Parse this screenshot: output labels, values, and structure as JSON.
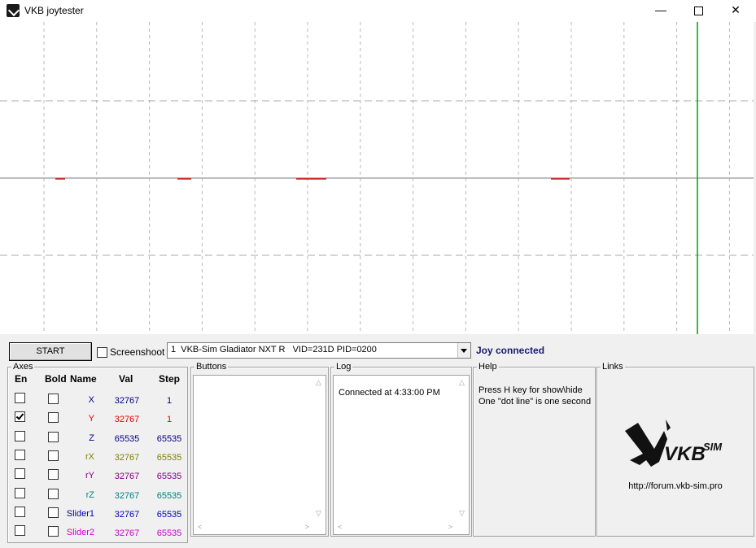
{
  "window": {
    "title": "VKB joytester"
  },
  "controls": {
    "start_label": "START",
    "screenshot_label": "Screenshoot",
    "screenshot_checked": false,
    "device": "1  VKB-Sim Gladiator NXT R   VID=231D PID=0200",
    "status": "Joy connected"
  },
  "axes": {
    "title": "Axes",
    "headers": {
      "en": "En",
      "bold": "Bold",
      "name": "Name",
      "val": "Val",
      "step": "Step"
    },
    "rows": [
      {
        "name": "X",
        "val": "32767",
        "step": "1",
        "color": "#000080",
        "en": false,
        "bold": false
      },
      {
        "name": "Y",
        "val": "32767",
        "step": "1",
        "color": "#e00000",
        "en": true,
        "bold": false
      },
      {
        "name": "Z",
        "val": "65535",
        "step": "65535",
        "color": "#000080",
        "en": false,
        "bold": false
      },
      {
        "name": "rX",
        "val": "32767",
        "step": "65535",
        "color": "#808000",
        "en": false,
        "bold": false
      },
      {
        "name": "rY",
        "val": "32767",
        "step": "65535",
        "color": "#800080",
        "en": false,
        "bold": false
      },
      {
        "name": "rZ",
        "val": "32767",
        "step": "65535",
        "color": "#008080",
        "en": false,
        "bold": false
      },
      {
        "name": "Slider1",
        "val": "32767",
        "step": "65535",
        "color": "#0000c0",
        "en": false,
        "bold": false
      },
      {
        "name": "Slider2",
        "val": "32767",
        "step": "65535",
        "color": "#d000d0",
        "en": false,
        "bold": false
      }
    ]
  },
  "buttons": {
    "title": "Buttons"
  },
  "log": {
    "title": "Log",
    "lines": [
      "Connected at 4:33:00 PM"
    ]
  },
  "help": {
    "title": "Help",
    "line1": "Press H key for show\\hide",
    "line2": "One \"dot line\" is one second"
  },
  "links": {
    "title": "Links",
    "url": "http://forum.vkb-sim.pro",
    "logo_text": "VKBSIM"
  },
  "icons": {
    "app": "vkb-bird-icon",
    "minimize": "minimize-icon",
    "maximize": "maximize-icon",
    "close": "close-icon"
  }
}
